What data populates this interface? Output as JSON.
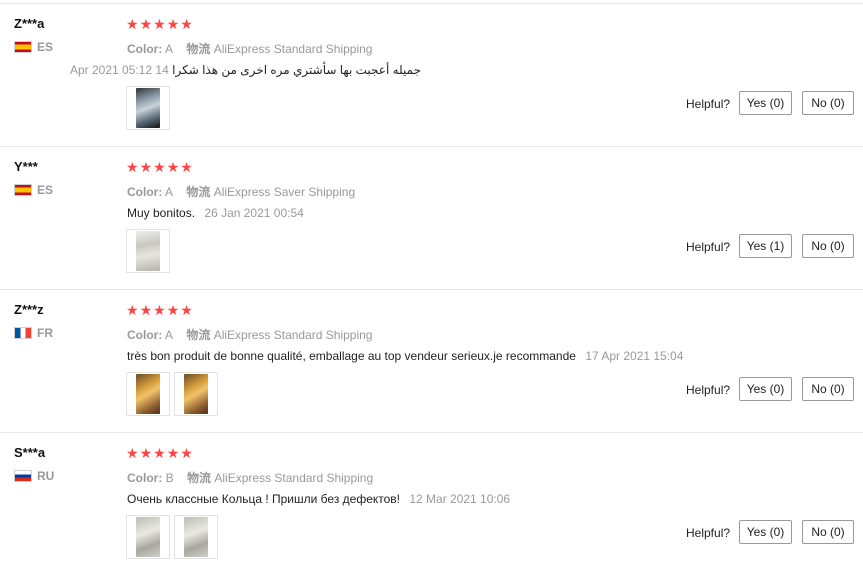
{
  "reviews": [
    {
      "user": "Z***a",
      "country": "ES",
      "stars": 5,
      "color_label": "Color:",
      "color_value": "A",
      "shipping_label": "物流",
      "shipping_value": "AliExpress Standard Shipping",
      "text": "جميله أعجبت بها سأشتري مره اخرى من هذا شكرا",
      "date": "14 Apr 2021 05:12",
      "photos": 1,
      "helpful": "Helpful?",
      "yes": "Yes (0)",
      "no": "No (0)"
    },
    {
      "user": "Y***",
      "country": "ES",
      "stars": 5,
      "color_label": "Color:",
      "color_value": "A",
      "shipping_label": "物流",
      "shipping_value": "AliExpress Saver Shipping",
      "text": "Muy bonitos.",
      "date": "26 Jan 2021 00:54",
      "photos": 1,
      "helpful": "Helpful?",
      "yes": "Yes (1)",
      "no": "No (0)"
    },
    {
      "user": "Z***z",
      "country": "FR",
      "stars": 5,
      "color_label": "Color:",
      "color_value": "A",
      "shipping_label": "物流",
      "shipping_value": "AliExpress Standard Shipping",
      "text": "très bon produit de bonne qualité, emballage au top vendeur serieux.je recommande",
      "date": "17 Apr 2021 15:04",
      "photos": 2,
      "helpful": "Helpful?",
      "yes": "Yes (0)",
      "no": "No (0)"
    },
    {
      "user": "S***a",
      "country": "RU",
      "stars": 5,
      "color_label": "Color:",
      "color_value": "B",
      "shipping_label": "物流",
      "shipping_value": "AliExpress Standard Shipping",
      "text": "Очень классные Кольца ! Пришли без дефектов!",
      "date": "12 Mar 2021 10:06",
      "photos": 2,
      "helpful": "Helpful?",
      "yes": "Yes (0)",
      "no": "No (0)"
    }
  ],
  "colors": {
    "star": "#ff4444",
    "muted": "#999999",
    "border": "#e8e8e8"
  }
}
